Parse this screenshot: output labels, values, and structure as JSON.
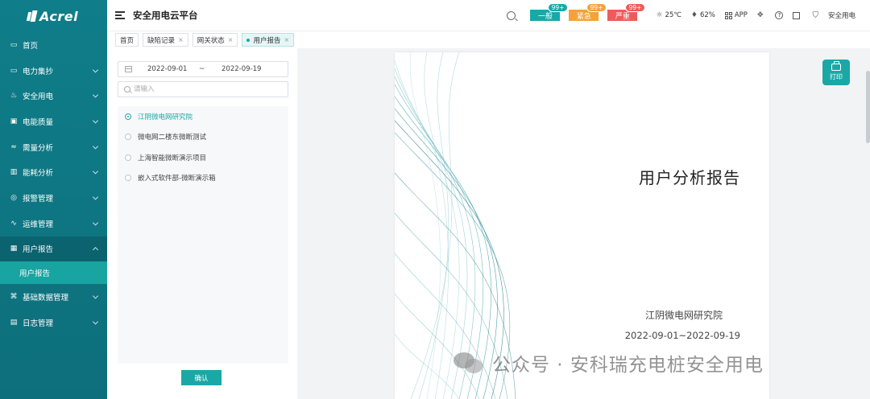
{
  "brand": {
    "logo_text": "Acrel"
  },
  "sidebar": {
    "items": [
      {
        "label": "首页",
        "icon": "monitor-icon",
        "has_children": false
      },
      {
        "label": "电力集抄",
        "icon": "monitor-icon",
        "has_children": true
      },
      {
        "label": "安全用电",
        "icon": "flame-icon",
        "has_children": true
      },
      {
        "label": "电能质量",
        "icon": "screen-icon",
        "has_children": true
      },
      {
        "label": "需量分析",
        "icon": "trend-icon",
        "has_children": true
      },
      {
        "label": "能耗分析",
        "icon": "bar-chart-icon",
        "has_children": true
      },
      {
        "label": "报警管理",
        "icon": "alarm-icon",
        "has_children": true
      },
      {
        "label": "运维管理",
        "icon": "pulse-icon",
        "has_children": true
      },
      {
        "label": "用户报告",
        "icon": "report-icon",
        "has_children": true,
        "open": true
      },
      {
        "label": "基础数据管理",
        "icon": "network-icon",
        "has_children": true
      },
      {
        "label": "日志管理",
        "icon": "log-icon",
        "has_children": true
      }
    ],
    "submenu": {
      "label": "用户报告"
    }
  },
  "header": {
    "title": "安全用电云平台",
    "alerts": {
      "general": {
        "label": "一般",
        "count": "99+",
        "color": "#1aa8a6"
      },
      "urgent": {
        "label": "紧急",
        "count": "99+",
        "color": "#f3a23c"
      },
      "severe": {
        "label": "严重",
        "count": "99+",
        "color": "#ef5b5b"
      }
    },
    "temperature": "25℃",
    "humidity": "62%",
    "app_label": "APP",
    "user_label": "安全用电"
  },
  "tabs": [
    {
      "label": "首页",
      "closable": false,
      "active": false
    },
    {
      "label": "缺陷记录",
      "closable": true,
      "active": false
    },
    {
      "label": "网关状态",
      "closable": true,
      "active": false
    },
    {
      "label": "用户报告",
      "closable": true,
      "active": true
    }
  ],
  "filter": {
    "date_start": "2022-09-01",
    "date_separator": "~",
    "date_end": "2022-09-19",
    "search_placeholder": "请输入",
    "projects": [
      {
        "label": "江阴微电网研究院",
        "selected": true
      },
      {
        "label": "微电网二楼东微断测试",
        "selected": false
      },
      {
        "label": "上海智能微断演示项目",
        "selected": false
      },
      {
        "label": "嵌入式软件部-微断演示箱",
        "selected": false
      }
    ],
    "confirm_label": "确认"
  },
  "report": {
    "title": "用户分析报告",
    "organization": "江阴微电网研究院",
    "date_range": "2022-09-01~2022-09-19",
    "print_label": "打印"
  },
  "watermark": {
    "text": "公众号 · 安科瑞充电桩安全用电"
  },
  "colors": {
    "primary": "#1aa8a6",
    "sidebar": "#0f7e8a"
  }
}
